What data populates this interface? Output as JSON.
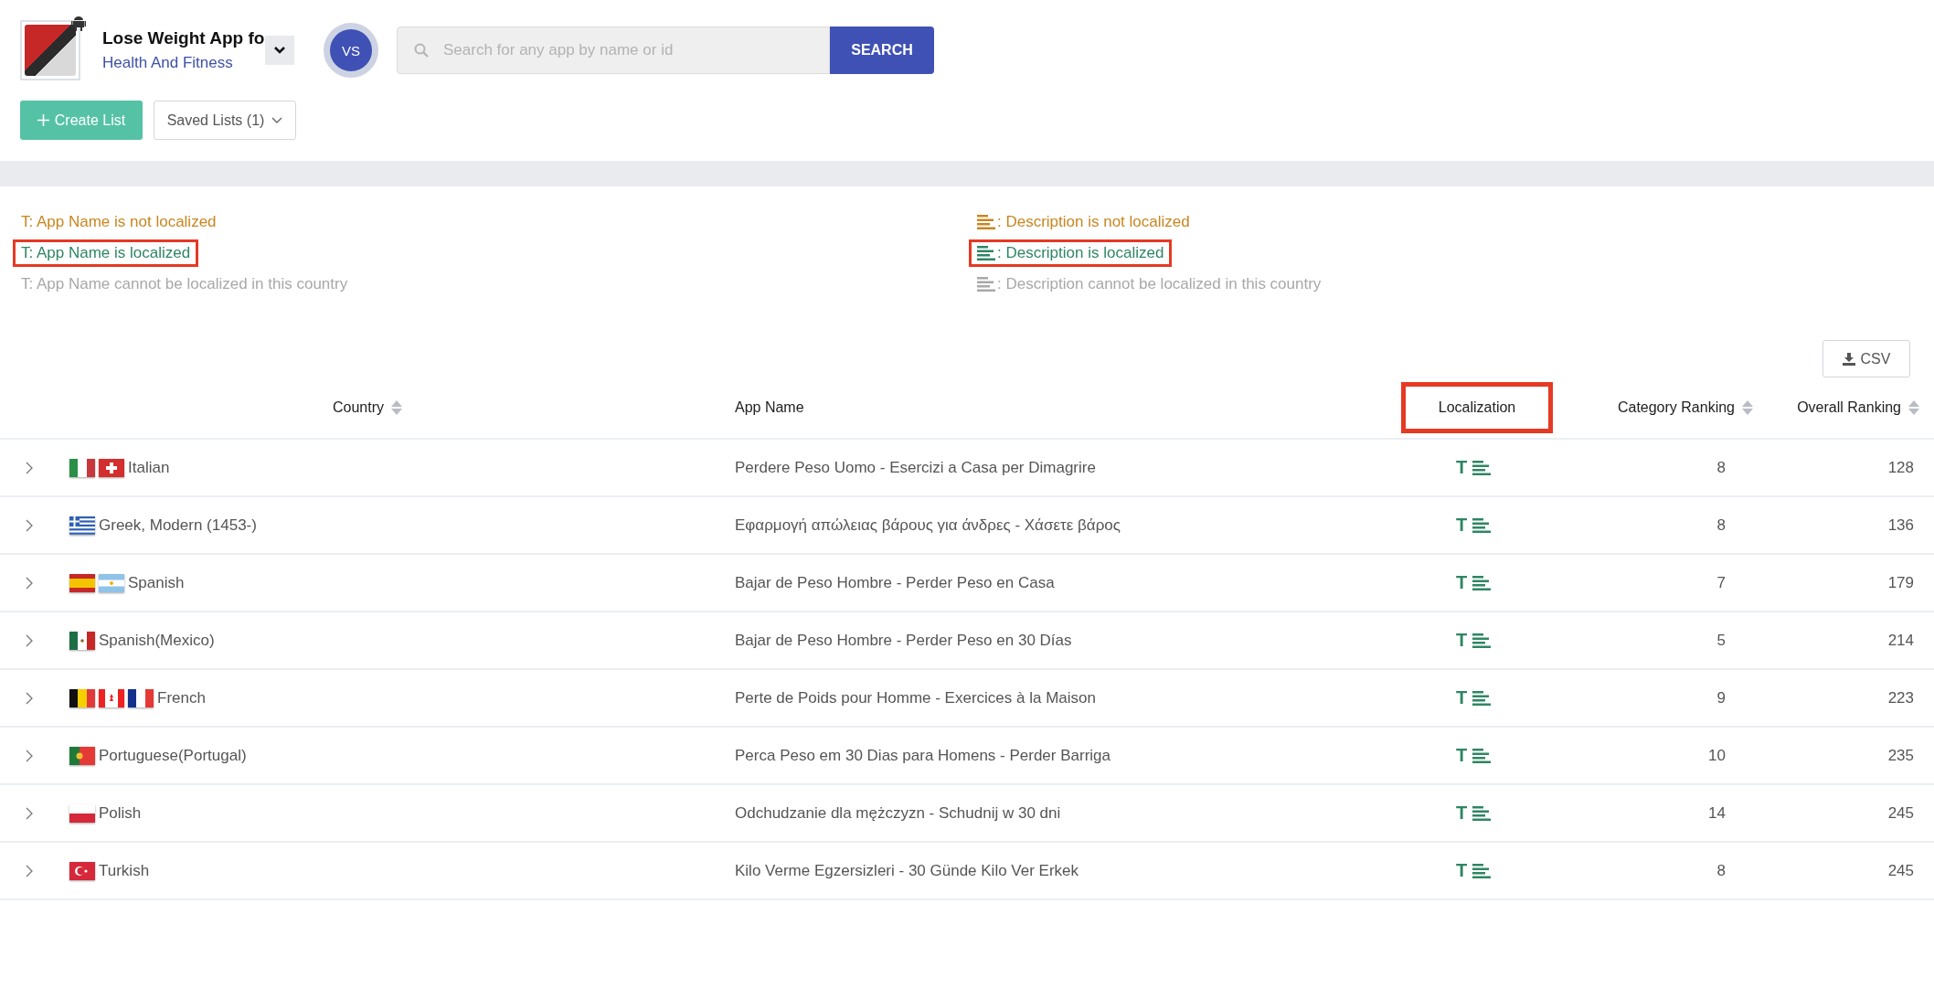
{
  "app": {
    "title": "Lose Weight App fo",
    "category": "Health And Fitness"
  },
  "vs": "VS",
  "search": {
    "placeholder": "Search for any app by name or id",
    "button": "SEARCH"
  },
  "lists": {
    "create": "Create List",
    "saved": "Saved Lists (1)"
  },
  "legend": [
    {
      "kind": "name",
      "color": "#c8861f",
      "symbol": "T",
      "text": ": App Name is not localized",
      "highlighted": false
    },
    {
      "kind": "description",
      "color": "#c8861f",
      "text": ": Description is not localized",
      "highlighted": false
    },
    {
      "kind": "name",
      "color": "#2e8663",
      "symbol": "T",
      "text": ": App Name is localized",
      "highlighted": true
    },
    {
      "kind": "description",
      "color": "#2e8663",
      "text": ": Description is localized",
      "highlighted": true
    },
    {
      "kind": "name",
      "color": "#a8a8a8",
      "symbol": "T",
      "text": ": App Name cannot be localized in this country",
      "highlighted": false
    },
    {
      "kind": "description",
      "color": "#a8a8a8",
      "text": ": Description cannot be localized in this country",
      "highlighted": false
    }
  ],
  "csv": "CSV",
  "table": {
    "columns": [
      {
        "label": "Country",
        "sortable": true,
        "highlighted": false
      },
      {
        "label": "App Name",
        "sortable": false,
        "highlighted": false
      },
      {
        "label": "Localization",
        "sortable": false,
        "highlighted": true
      },
      {
        "label": "Category Ranking",
        "sortable": true,
        "highlighted": false
      },
      {
        "label": "Overall Ranking",
        "sortable": true,
        "highlighted": false
      }
    ],
    "rows": [
      {
        "flags": [
          {
            "kind": "italy"
          },
          {
            "kind": "switzerland"
          }
        ],
        "country": "Italian",
        "app_name": "Perdere Peso Uomo - Esercizi a Casa per Dimagrire",
        "name_symbol": "T",
        "name_localized": true,
        "description_localized": true,
        "category_ranking": "8",
        "overall_ranking": "128"
      },
      {
        "flags": [
          {
            "kind": "greece"
          }
        ],
        "country": "Greek, Modern (1453-)",
        "app_name": "Εφαρμογή απώλειας βάρους για άνδρες - Χάσετε βάρος",
        "name_symbol": "T",
        "name_localized": true,
        "description_localized": true,
        "category_ranking": "8",
        "overall_ranking": "136"
      },
      {
        "flags": [
          {
            "kind": "spain"
          },
          {
            "kind": "argentina"
          }
        ],
        "country": "Spanish",
        "app_name": "Bajar de Peso Hombre - Perder Peso en Casa",
        "name_symbol": "T",
        "name_localized": true,
        "description_localized": true,
        "category_ranking": "7",
        "overall_ranking": "179"
      },
      {
        "flags": [
          {
            "kind": "mexico"
          }
        ],
        "country": "Spanish(Mexico)",
        "app_name": "Bajar de Peso Hombre - Perder Peso en 30 Días",
        "name_symbol": "T",
        "name_localized": true,
        "description_localized": true,
        "category_ranking": "5",
        "overall_ranking": "214"
      },
      {
        "flags": [
          {
            "kind": "belgium"
          },
          {
            "kind": "canada"
          },
          {
            "kind": "france"
          }
        ],
        "country": "French",
        "app_name": "Perte de Poids pour Homme - Exercices à la Maison",
        "name_symbol": "T",
        "name_localized": true,
        "description_localized": true,
        "category_ranking": "9",
        "overall_ranking": "223"
      },
      {
        "flags": [
          {
            "kind": "portugal"
          }
        ],
        "country": "Portuguese(Portugal)",
        "app_name": "Perca Peso em 30 Dias para Homens - Perder Barriga",
        "name_symbol": "T",
        "name_localized": true,
        "description_localized": true,
        "category_ranking": "10",
        "overall_ranking": "235"
      },
      {
        "flags": [
          {
            "kind": "poland"
          }
        ],
        "country": "Polish",
        "app_name": "Odchudzanie dla mężczyzn - Schudnij w 30 dni",
        "name_symbol": "T",
        "name_localized": true,
        "description_localized": true,
        "category_ranking": "14",
        "overall_ranking": "245"
      },
      {
        "flags": [
          {
            "kind": "turkey"
          }
        ],
        "country": "Turkish",
        "app_name": "Kilo Verme Egzersizleri - 30 Günde Kilo Ver Erkek",
        "name_symbol": "T",
        "name_localized": true,
        "description_localized": true,
        "category_ranking": "8",
        "overall_ranking": "245"
      }
    ]
  }
}
